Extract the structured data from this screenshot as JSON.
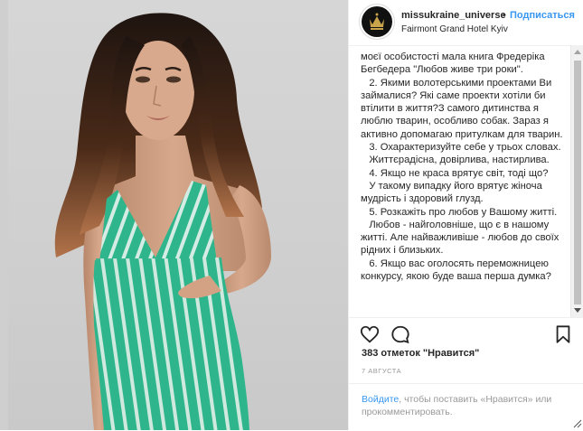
{
  "header": {
    "username": "missukraine_universe",
    "separator": "•",
    "follow_label": "Подписаться",
    "location": "Fairmont Grand Hotel Kyiv"
  },
  "caption": {
    "lines": [
      "моєї особистості мала книга Фредеріка Бегбедера \"Любов живе три роки\".",
      "   2. Якими волотерськими проектами Ви займалися? Які саме проекти хотіли би втілити в життя?З самого дитинства я люблю тварин, особливо собак. Зараз я активно допомагаю притулкам для тварин.",
      "   3. Охарактеризуйте себе у трьох словах.",
      "   Життєрадісна, довірлива, настирлива.",
      "   4. Якщо не краса врятує світ, тоді що?",
      "   У такому випадку його врятує жіноча мудрість і здоровий глузд.",
      "   5. Розкажіть про любов у Вашому житті.",
      "   Любов - найголовніше, що є в нашому житті. Але найважливіше - любов до своїх рідних і близьких.",
      "   6. Якщо вас оголосять переможницею конкурсу, якою буде ваша перша думка?"
    ]
  },
  "actions": {
    "like_icon": "heart-icon",
    "comment_icon": "comment-icon",
    "save_icon": "bookmark-icon"
  },
  "likes": "383 отметок \"Нравится\"",
  "date": "7 АВГУСТА",
  "footer": {
    "login_link": "Войдите",
    "text_middle": ", чтобы поставить «Нравится»",
    "text_or": "или",
    "comment_link": "прокомментировать",
    "text_end": "."
  },
  "photo": {
    "subject": "woman-in-green-striped-dress",
    "dress_color": "#2fb58c",
    "background_color": "#d2d2d2"
  }
}
